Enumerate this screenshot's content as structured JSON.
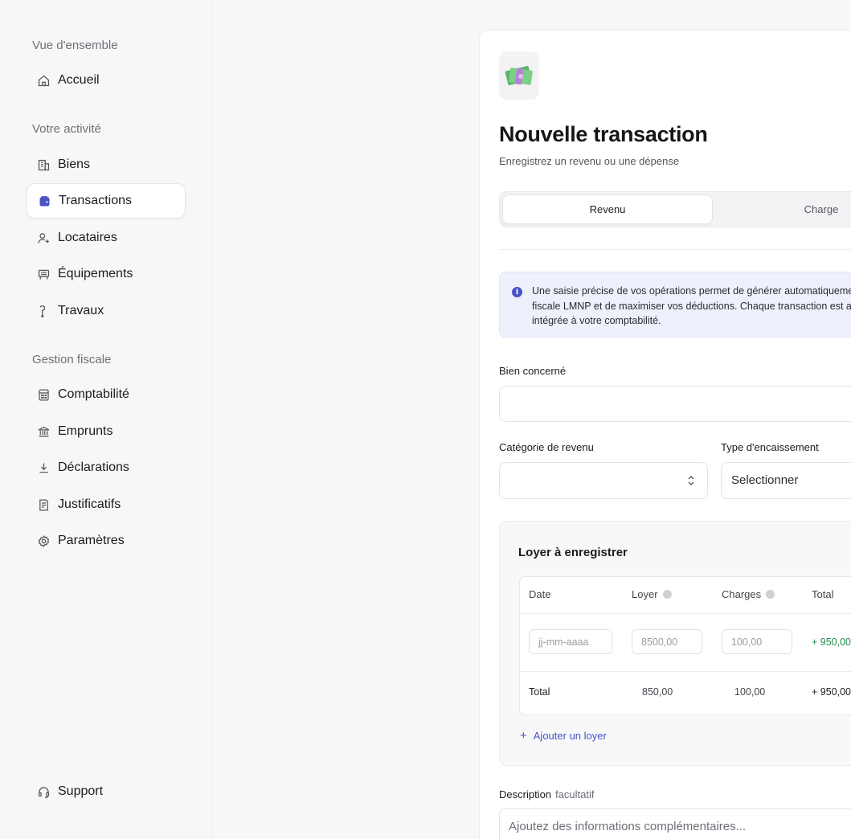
{
  "sidebar": {
    "sections": [
      {
        "label": "Vue d'ensemble"
      },
      {
        "label": "Votre activité"
      },
      {
        "label": "Gestion fiscale"
      }
    ],
    "items": {
      "accueil": {
        "label": "Accueil",
        "icon": "home-icon"
      },
      "biens": {
        "label": "Biens",
        "icon": "building-icon"
      },
      "transactions": {
        "label": "Transactions",
        "icon": "wallet-icon",
        "active": true
      },
      "locataires": {
        "label": "Locataires",
        "icon": "user-add-icon"
      },
      "equipements": {
        "label": "Équipements",
        "icon": "furniture-icon"
      },
      "travaux": {
        "label": "Travaux",
        "icon": "paint-roller-icon"
      },
      "comptabilite": {
        "label": "Comptabilité",
        "icon": "calculator-icon"
      },
      "emprunts": {
        "label": "Emprunts",
        "icon": "bank-icon"
      },
      "declarations": {
        "label": "Déclarations",
        "icon": "download-icon"
      },
      "justificatifs": {
        "label": "Justificatifs",
        "icon": "receipt-icon"
      },
      "parametres": {
        "label": "Paramètres",
        "icon": "gear-icon"
      },
      "support": {
        "label": "Support",
        "icon": "headset-icon"
      }
    }
  },
  "form": {
    "title": "Nouvelle transaction",
    "subtitle": "Enregistrez un revenu ou une dépense",
    "tabs": [
      {
        "label": "Revenu",
        "selected": true
      },
      {
        "label": "Charge",
        "selected": false
      }
    ],
    "info": "Une saisie précise de vos opérations permet de générer automatiquemen\nfiscale LMNP et de maximiser vos déductions. Chaque transaction est aut\nintégrée à votre comptabilité.",
    "bien_label": "Bien concerné",
    "categorie_label": "Catégorie de revenu",
    "type_label": "Type d'encaissement",
    "type_value": "Selectionner",
    "loyer": {
      "title": "Loyer à enregistrer",
      "headers": {
        "date": "Date",
        "loyer": "Loyer",
        "charges": "Charges",
        "total": "Total"
      },
      "row": {
        "date_placeholder": "jj-mm-aaaa",
        "loyer": "8500,00",
        "charges": "100,00",
        "total": "+ 950,00"
      },
      "footer": {
        "label": "Total",
        "loyer": "850,00",
        "charges": "100,00",
        "total": "+ 950,00"
      },
      "add_label": "Ajouter un loyer"
    },
    "description_label": "Description",
    "description_optional": "facultatif",
    "description_placeholder": "Ajoutez des informations complémentaires..."
  },
  "colors": {
    "accent": "#4a52c9",
    "positive": "#1f8a4c",
    "info_bg": "#eef0fb"
  }
}
